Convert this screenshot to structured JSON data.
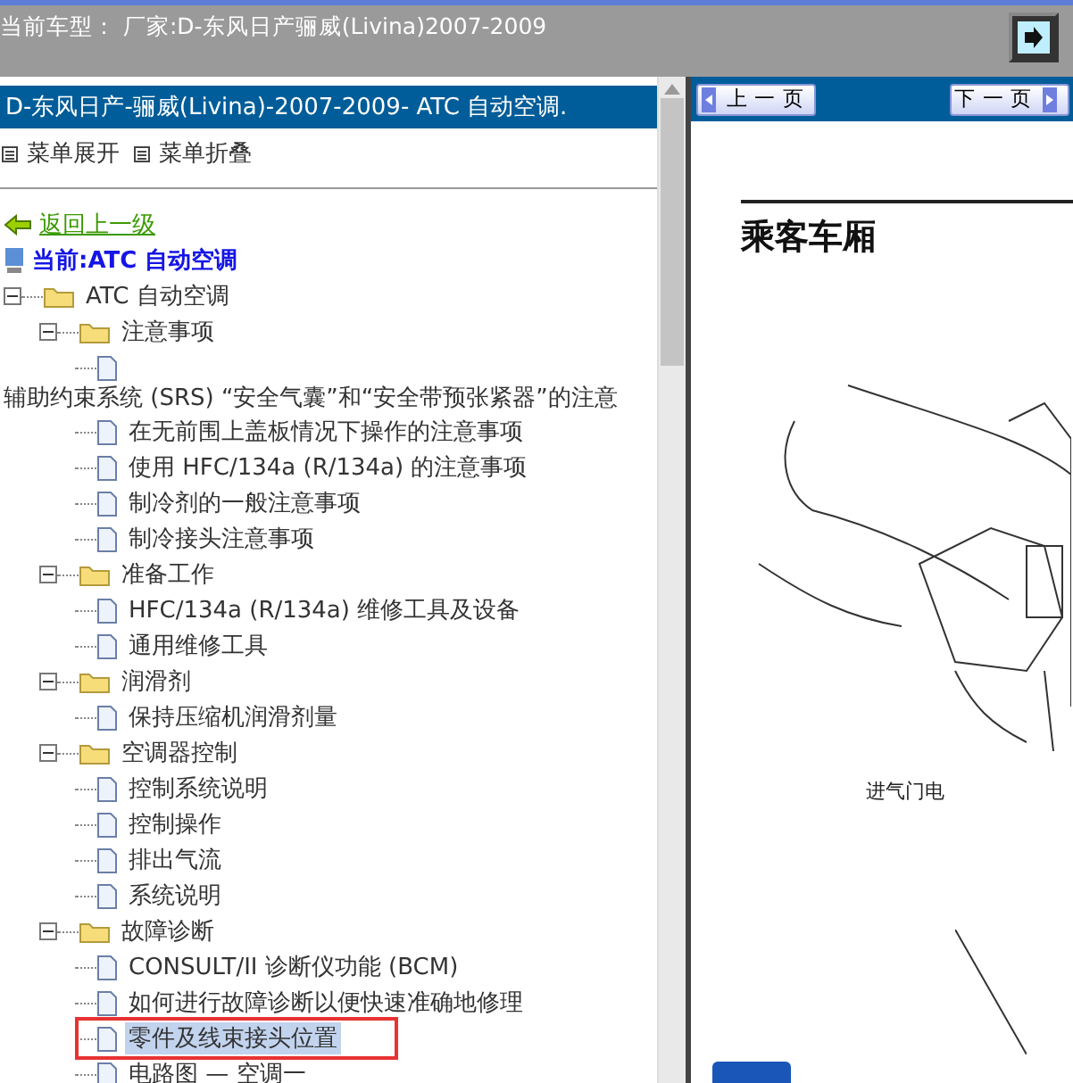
{
  "header": {
    "title": "当前车型：  厂家:D-东风日产骊威(Livina)2007-2009"
  },
  "left_pane": {
    "title": "D-东风日产-骊威(Livina)-2007-2009- ATC 自动空调.",
    "menu": [
      "菜单展开",
      "菜单折叠"
    ],
    "back_link": "返回上一级",
    "current": "当前:ATC 自动空调",
    "tree": [
      {
        "label": "ATC 自动空调",
        "kind": "folder",
        "expanded": true,
        "children": [
          {
            "label": "注意事项",
            "kind": "folder",
            "expanded": true,
            "children": [
              {
                "label": "辅助约束系统 (SRS) “安全气囊”和“安全带预张紧器”的注意",
                "kind": "wrapped",
                "selected": false
              },
              {
                "label": "在无前围上盖板情况下操作的注意事项",
                "kind": "doc",
                "selected": false
              },
              {
                "label": "使用 HFC/134a (R/134a) 的注意事项",
                "kind": "doc",
                "selected": false
              },
              {
                "label": "制冷剂的一般注意事项",
                "kind": "doc",
                "selected": false
              },
              {
                "label": "制冷接头注意事项",
                "kind": "doc",
                "selected": false
              }
            ]
          },
          {
            "label": "准备工作",
            "kind": "folder",
            "expanded": true,
            "children": [
              {
                "label": "HFC/134a (R/134a) 维修工具及设备",
                "kind": "doc",
                "selected": false
              },
              {
                "label": "通用维修工具",
                "kind": "doc",
                "selected": false
              }
            ]
          },
          {
            "label": "润滑剂",
            "kind": "folder",
            "expanded": true,
            "children": [
              {
                "label": "保持压缩机润滑剂量",
                "kind": "doc",
                "selected": false
              }
            ]
          },
          {
            "label": "空调器控制",
            "kind": "folder",
            "expanded": true,
            "children": [
              {
                "label": "控制系统说明",
                "kind": "doc",
                "selected": false
              },
              {
                "label": "控制操作",
                "kind": "doc",
                "selected": false
              },
              {
                "label": "排出气流",
                "kind": "doc",
                "selected": false
              },
              {
                "label": "系统说明",
                "kind": "doc",
                "selected": false
              }
            ]
          },
          {
            "label": "故障诊断",
            "kind": "folder",
            "expanded": true,
            "children": [
              {
                "label": "CONSULT/II 诊断仪功能 (BCM)",
                "kind": "doc",
                "selected": false
              },
              {
                "label": "如何进行故障诊断以便快速准确地修理",
                "kind": "doc",
                "selected": false
              },
              {
                "label": "零件及线束接头位置",
                "kind": "doc",
                "selected": true,
                "marked": true
              },
              {
                "label": "电路图 — 空调一",
                "kind": "doc",
                "selected": false
              }
            ]
          }
        ]
      }
    ]
  },
  "right_pane": {
    "buttons": [
      "上 一 页",
      "下 一 页"
    ],
    "heading": "乘客车厢",
    "caption": "进气门电"
  }
}
